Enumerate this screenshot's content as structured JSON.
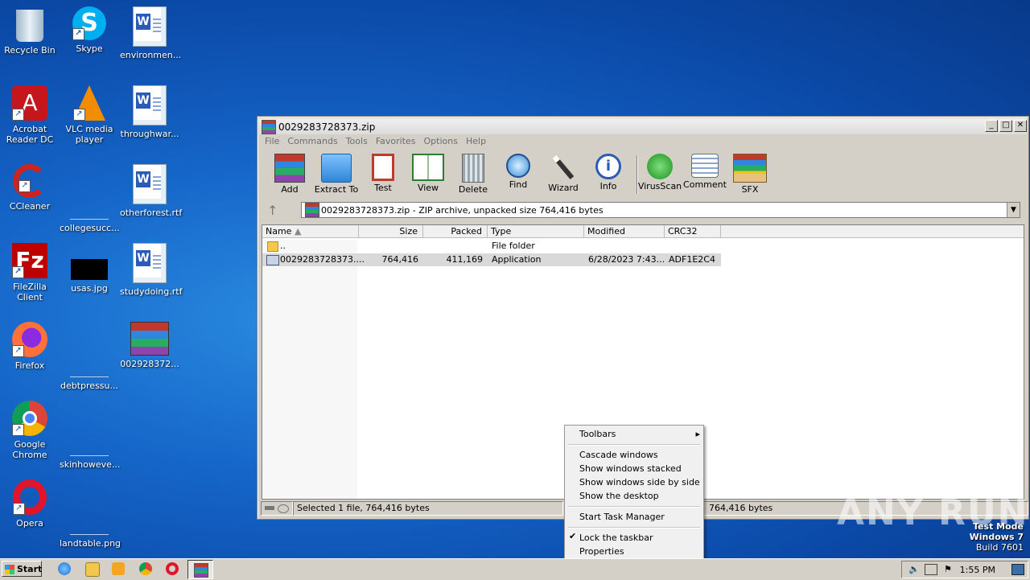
{
  "desktop": {
    "icons": [
      {
        "label": "Recycle Bin"
      },
      {
        "label": "Skype"
      },
      {
        "label": "environmen..."
      },
      {
        "label": "Acrobat Reader DC"
      },
      {
        "label": "VLC media player"
      },
      {
        "label": "throughwar..."
      },
      {
        "label": "CCleaner"
      },
      {
        "label": "collegesucc..."
      },
      {
        "label": "otherforest.rtf"
      },
      {
        "label": "FileZilla Client"
      },
      {
        "label": "usas.jpg"
      },
      {
        "label": "studydoing.rtf"
      },
      {
        "label": "Firefox"
      },
      {
        "label": "debtpressu..."
      },
      {
        "label": "002928372..."
      },
      {
        "label": "Google Chrome"
      },
      {
        "label": "skinhoweve..."
      },
      {
        "label": "Opera"
      },
      {
        "label": "landtable.png"
      }
    ]
  },
  "window": {
    "title": "0029283728373.zip",
    "menu": [
      "File",
      "Commands",
      "Tools",
      "Favorites",
      "Options",
      "Help"
    ],
    "toolbar": [
      "Add",
      "Extract To",
      "Test",
      "View",
      "Delete",
      "Find",
      "Wizard",
      "Info",
      "VirusScan",
      "Comment",
      "SFX"
    ],
    "address": "0029283728373.zip - ZIP archive, unpacked size 764,416 bytes",
    "columns": [
      "Name",
      "Size",
      "Packed",
      "Type",
      "Modified",
      "CRC32"
    ],
    "rows": [
      {
        "name": "..",
        "size": "",
        "packed": "",
        "type": "File folder",
        "modified": "",
        "crc": ""
      },
      {
        "name": "0029283728373....",
        "size": "764,416",
        "packed": "411,169",
        "type": "Application",
        "modified": "6/28/2023 7:43...",
        "crc": "ADF1E2C4"
      }
    ],
    "status_left": "Selected 1 file, 764,416 bytes",
    "status_right": "764,416 bytes"
  },
  "context_menu": {
    "items": [
      "Toolbars",
      "Cascade windows",
      "Show windows stacked",
      "Show windows side by side",
      "Show the desktop",
      "Start Task Manager",
      "Lock the taskbar",
      "Properties"
    ]
  },
  "taskbar": {
    "start": "Start",
    "clock": "1:55 PM"
  },
  "watermark": {
    "line1": "Test Mode",
    "line2": "Windows 7",
    "line3": "Build 7601",
    "brand": "ANY RUN"
  },
  "colors": {
    "desktop": "#1565c8",
    "window_face": "#d4d0c8",
    "selection": "#d9d9d9"
  }
}
